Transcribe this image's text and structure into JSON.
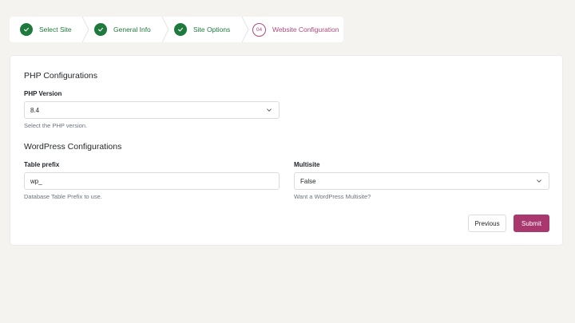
{
  "stepper": {
    "steps": [
      {
        "label": "Select Site",
        "status": "done"
      },
      {
        "label": "General Info",
        "status": "done"
      },
      {
        "label": "Site Options",
        "status": "done"
      },
      {
        "label": "Website Configuration",
        "status": "current",
        "number": "04"
      }
    ]
  },
  "php": {
    "section_title": "PHP Configurations",
    "version_label": "PHP Version",
    "version_value": "8.4",
    "version_helper": "Select the PHP version."
  },
  "wordpress": {
    "section_title": "WordPress Configurations",
    "table_prefix_label": "Table prefix",
    "table_prefix_value": "wp_",
    "table_prefix_helper": "Database Table Prefix to use.",
    "multisite_label": "Multisite",
    "multisite_value": "False",
    "multisite_helper": "Want a WordPress Multisite?"
  },
  "actions": {
    "previous_label": "Previous",
    "submit_label": "Submit"
  },
  "colors": {
    "done_green": "#1e7a3c",
    "accent_magenta": "#a8386e",
    "background": "#f4f3f0"
  }
}
